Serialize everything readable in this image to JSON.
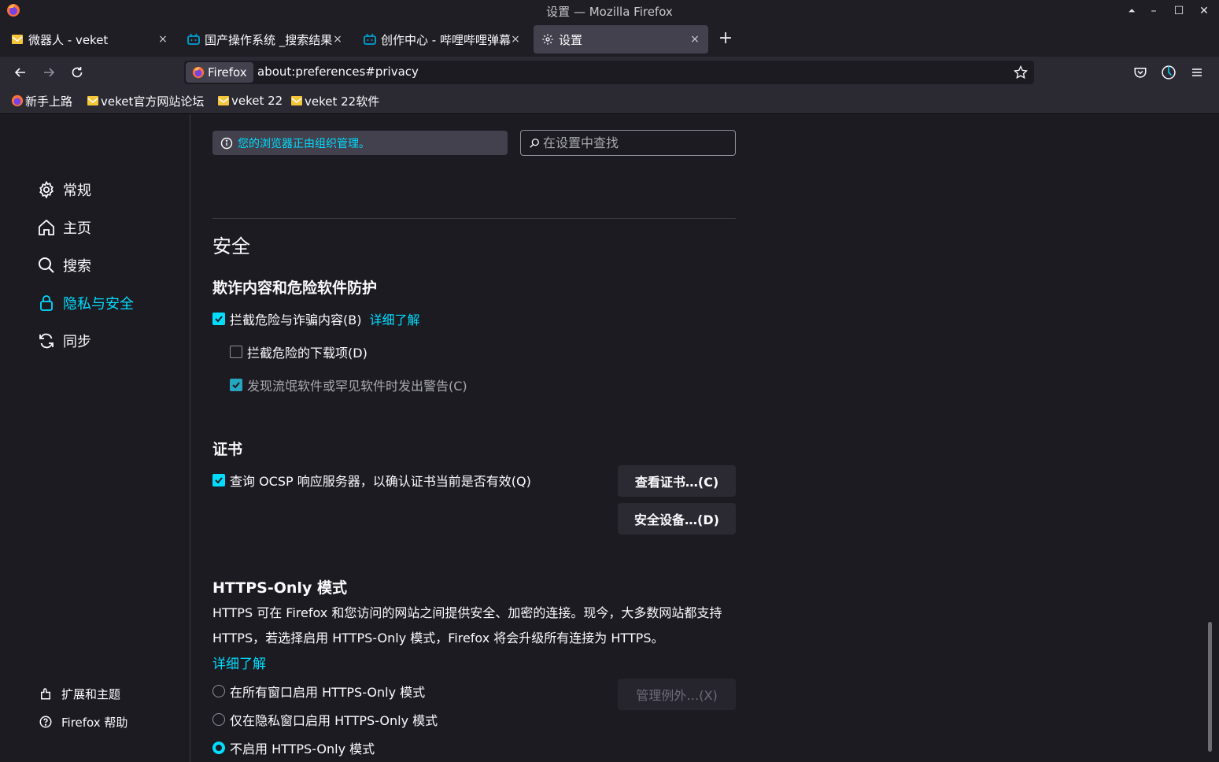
{
  "window": {
    "title": "设置 — Mozilla Firefox",
    "controls": {
      "up": "⏶",
      "minimize": "–",
      "maximize": "☐",
      "close": "✕"
    }
  },
  "tabs": [
    {
      "label": "微器人 - veket",
      "icon": "veket-favicon",
      "active": false
    },
    {
      "label": "国产操作系统 _搜索结果",
      "icon": "bilibili-favicon",
      "active": false
    },
    {
      "label": "创作中心 - 哔哩哔哩弹幕",
      "icon": "bilibili-favicon",
      "active": false
    },
    {
      "label": "设置",
      "icon": "gear-icon",
      "active": true
    }
  ],
  "tab_close": "×",
  "new_tab": "+",
  "navbar": {
    "identity_label": "Firefox",
    "url": "about:preferences#privacy"
  },
  "bookmarks": [
    {
      "label": "新手上路",
      "icon": "firefox-favicon"
    },
    {
      "label": "veket官方网站论坛",
      "icon": "veket-favicon"
    },
    {
      "label": "veket 22",
      "icon": "veket-favicon"
    },
    {
      "label": "veket 22软件",
      "icon": "veket-favicon"
    }
  ],
  "sidebar": {
    "categories": [
      {
        "label": "常规",
        "icon": "gear-icon"
      },
      {
        "label": "主页",
        "icon": "home-icon"
      },
      {
        "label": "搜索",
        "icon": "search-icon"
      },
      {
        "label": "隐私与安全",
        "icon": "lock-icon",
        "selected": true
      },
      {
        "label": "同步",
        "icon": "sync-icon"
      }
    ],
    "footer": [
      {
        "label": "扩展和主题",
        "icon": "puzzle-icon"
      },
      {
        "label": "Firefox 帮助",
        "icon": "help-icon"
      }
    ]
  },
  "policy_notice": "您的浏览器正由组织管理。",
  "search": {
    "placeholder": "在设置中查找"
  },
  "security": {
    "heading": "安全",
    "fraud": {
      "heading": "欺诈内容和危险软件防护",
      "block_dangerous": {
        "label": "拦截危险与诈骗内容(B)",
        "checked": true,
        "learn_more": "详细了解"
      },
      "block_downloads": {
        "label": "拦截危险的下载项(D)",
        "checked": false
      },
      "warn_unwanted": {
        "label": "发现流氓软件或罕见软件时发出警告(C)",
        "checked": true
      }
    },
    "certs": {
      "heading": "证书",
      "ocsp": {
        "label": "查询 OCSP 响应服务器，以确认证书当前是否有效(Q)",
        "checked": true
      },
      "view_button": "查看证书…(C)",
      "devices_button": "安全设备…(D)"
    },
    "https_only": {
      "heading": "HTTPS-Only 模式",
      "description": "HTTPS 可在 Firefox 和您访问的网站之间提供安全、加密的连接。现今，大多数网站都支持 HTTPS，若选择启用 HTTPS-Only 模式，Firefox 将会升级所有连接为 HTTPS。",
      "learn_more": "详细了解",
      "options": [
        {
          "label": "在所有窗口启用 HTTPS-Only 模式",
          "selected": false
        },
        {
          "label": "仅在隐私窗口启用 HTTPS-Only 模式",
          "selected": false
        },
        {
          "label": "不启用 HTTPS-Only 模式",
          "selected": true
        }
      ],
      "exceptions_button": "管理例外…(X)"
    }
  },
  "colors": {
    "accent": "#00ddff",
    "background": "#1c1b22",
    "toolbar": "#2b2a33"
  }
}
